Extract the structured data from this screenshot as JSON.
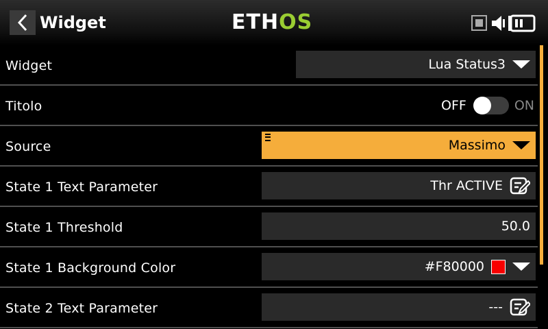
{
  "header": {
    "title": "Widget",
    "logo_part1": "ETH",
    "logo_part2": "OS"
  },
  "rows": [
    {
      "label": "Widget",
      "value": "Lua Status3",
      "control": "dropdown"
    },
    {
      "label": "Titolo",
      "off_label": "OFF",
      "on_label": "ON",
      "toggle_state": "off",
      "control": "toggle"
    },
    {
      "label": "Source",
      "value": "Massimo",
      "control": "dropdown-highlighted"
    },
    {
      "label": "State 1 Text Parameter",
      "value": "Thr ACTIVE",
      "control": "text-edit"
    },
    {
      "label": "State 1 Threshold",
      "value": "50.0",
      "control": "number"
    },
    {
      "label": "State 1 Background Color",
      "value": "#F80000",
      "color": "#F80000",
      "control": "color-picker"
    },
    {
      "label": "State 2 Text Parameter",
      "value": "---",
      "control": "text-edit"
    }
  ],
  "colors": {
    "accent": "#F5AD3B",
    "logo_green": "#9ACD32",
    "field_bg": "#2A2A2A"
  },
  "icons": [
    "back-icon",
    "rf-status-icon",
    "speaker-icon",
    "battery-icon",
    "menu-icon",
    "edit-icon",
    "dropdown-arrow-icon"
  ]
}
